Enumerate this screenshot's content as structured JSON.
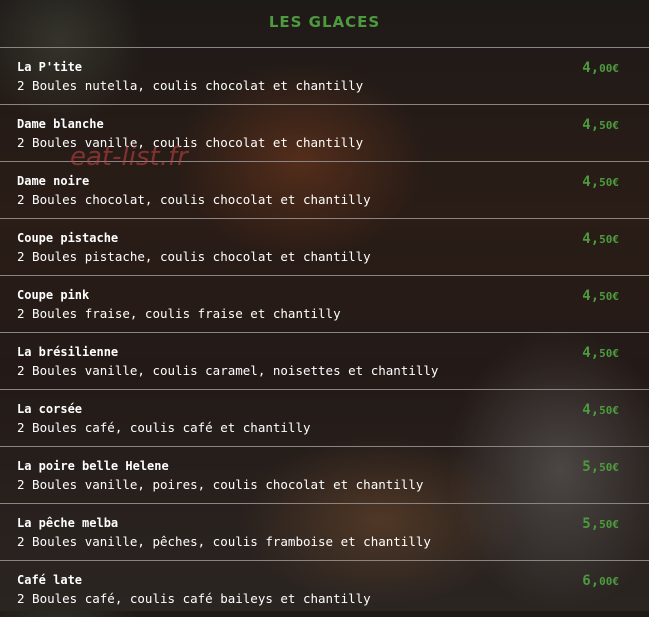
{
  "header": {
    "title": "LES GLACES"
  },
  "watermark": "eat-list.fr",
  "items": [
    {
      "name": "La P'tite",
      "description": "2 Boules nutella, coulis chocolat et chantilly",
      "price_main": "4,",
      "price_cents": "00€"
    },
    {
      "name": "Dame blanche",
      "description": "2 Boules vanille, coulis chocolat et chantilly",
      "price_main": "4,",
      "price_cents": "50€"
    },
    {
      "name": "Dame noire",
      "description": "2 Boules chocolat, coulis chocolat et chantilly",
      "price_main": "4,",
      "price_cents": "50€"
    },
    {
      "name": "Coupe pistache",
      "description": "2 Boules pistache, coulis chocolat et chantilly",
      "price_main": "4,",
      "price_cents": "50€"
    },
    {
      "name": "Coupe pink",
      "description": "2 Boules fraise, coulis fraise et chantilly",
      "price_main": "4,",
      "price_cents": "50€"
    },
    {
      "name": "La brésilienne",
      "description": "2 Boules vanille, coulis caramel, noisettes et chantilly",
      "price_main": "4,",
      "price_cents": "50€"
    },
    {
      "name": "La corsée",
      "description": "2 Boules café, coulis café et chantilly",
      "price_main": "4,",
      "price_cents": "50€"
    },
    {
      "name": "La poire belle Helene",
      "description": "2 Boules vanille, poires, coulis chocolat et chantilly",
      "price_main": "5,",
      "price_cents": "50€"
    },
    {
      "name": "La pêche melba",
      "description": "2 Boules vanille, pêches, coulis framboise et chantilly",
      "price_main": "5,",
      "price_cents": "50€"
    },
    {
      "name": "Café late",
      "description": "2 Boules café, coulis café baileys et chantilly",
      "price_main": "6,",
      "price_cents": "00€"
    }
  ]
}
